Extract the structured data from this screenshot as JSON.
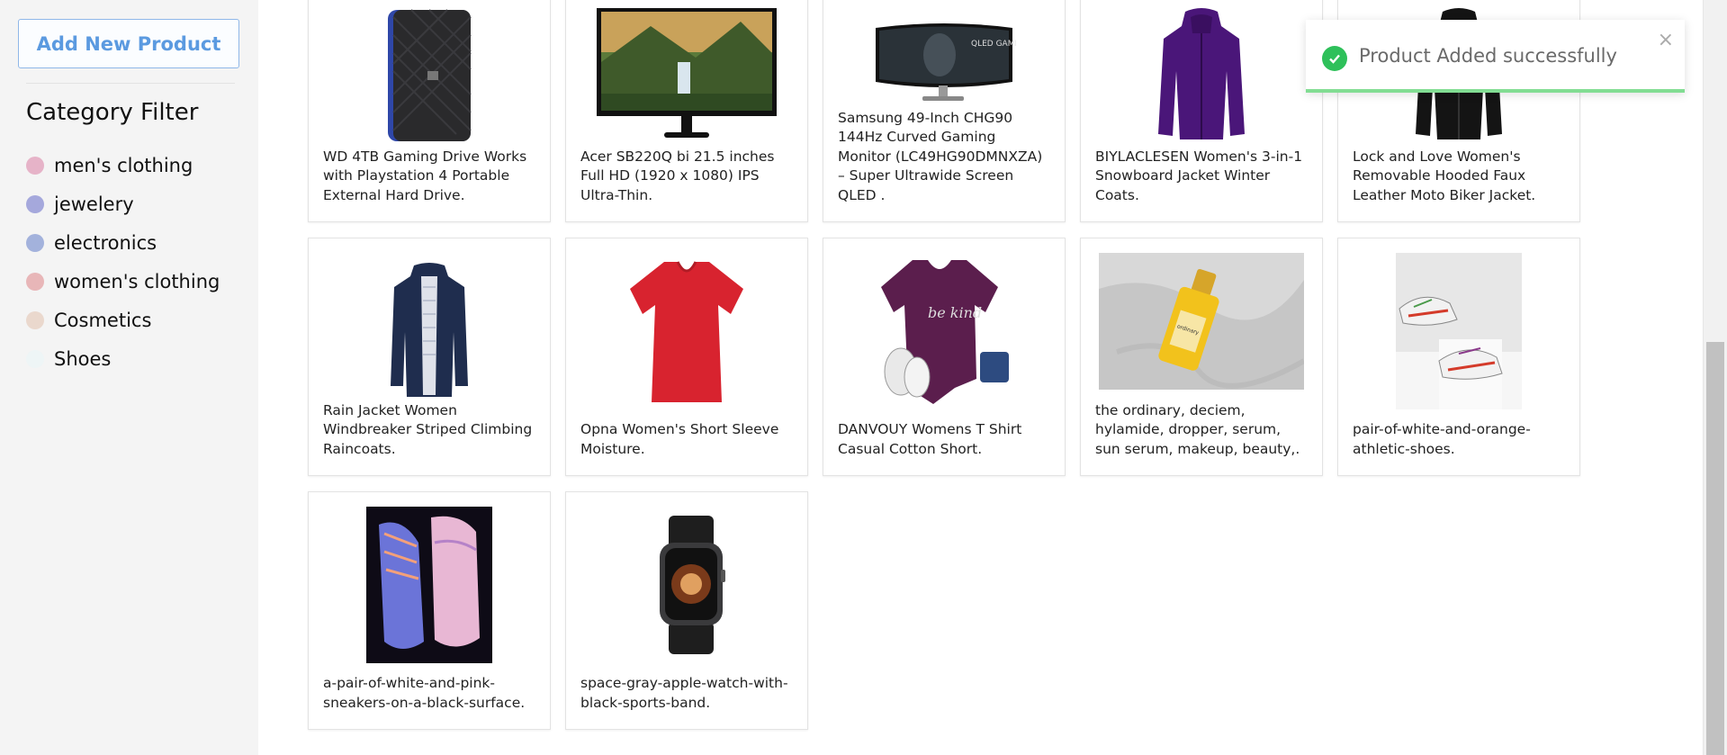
{
  "sidebar": {
    "add_button": "Add New Product",
    "filter_title": "Category Filter",
    "categories": [
      {
        "label": "men's clothing",
        "color": "#e6b3c8"
      },
      {
        "label": "jewelery",
        "color": "#a5a8dc"
      },
      {
        "label": "electronics",
        "color": "#a3b2dc"
      },
      {
        "label": "women's clothing",
        "color": "#e8b6b8"
      },
      {
        "label": "Cosmetics",
        "color": "#ead8cd"
      },
      {
        "label": "Shoes",
        "color": "#eef5f6"
      }
    ]
  },
  "products": [
    {
      "title": "WD 4TB Gaming Drive Works with Playstation 4 Portable External Hard Drive.",
      "image": "hard-drive"
    },
    {
      "title": "Acer SB220Q bi 21.5 inches Full HD (1920 x 1080) IPS Ultra-Thin.",
      "image": "monitor"
    },
    {
      "title": "Samsung 49-Inch CHG90 144Hz Curved Gaming Monitor (LC49HG90DMNXZA) – Super Ultrawide Screen QLED .",
      "image": "curved-monitor"
    },
    {
      "title": "BIYLACLESEN Women's 3-in-1 Snowboard Jacket Winter Coats.",
      "image": "purple-jacket"
    },
    {
      "title": "Lock and Love Women's Removable Hooded Faux Leather Moto Biker Jacket.",
      "image": "black-jacket"
    },
    {
      "title": "Rain Jacket Women Windbreaker Striped Climbing Raincoats.",
      "image": "rain-jacket"
    },
    {
      "title": "Opna Women's Short Sleeve Moisture.",
      "image": "red-tshirt"
    },
    {
      "title": "DANVOUY Womens T Shirt Casual Cotton Short.",
      "image": "purple-tshirt"
    },
    {
      "title": "the ordinary, deciem, hylamide, dropper, serum, sun serum, makeup, beauty,.",
      "image": "serum-bottle"
    },
    {
      "title": "pair-of-white-and-orange-athletic-shoes.",
      "image": "athletic-shoes"
    },
    {
      "title": "a-pair-of-white-and-pink-sneakers-on-a-black-surface.",
      "image": "pink-sneakers"
    },
    {
      "title": "space-gray-apple-watch-with-black-sports-band.",
      "image": "apple-watch"
    }
  ],
  "toast": {
    "message": "Product Added successfully",
    "close": "×"
  },
  "monitor_logo": "QLED GAMING MONITOR",
  "tshirt_text": "be kind",
  "serum_label": "ordinary"
}
